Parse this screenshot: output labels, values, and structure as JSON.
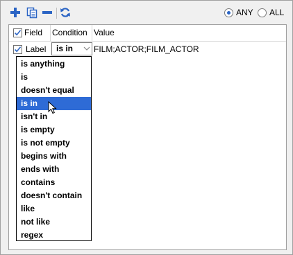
{
  "toolbar": {
    "add_icon": "plus-icon",
    "copy_icon": "copy-icon",
    "remove_icon": "minus-icon",
    "refresh_icon": "refresh-icon"
  },
  "match_mode": {
    "options": [
      "ANY",
      "ALL"
    ],
    "selected": "ANY"
  },
  "grid": {
    "headers": {
      "field": "Field",
      "condition": "Condition",
      "value": "Value"
    },
    "header_checked": true,
    "rows": [
      {
        "checked": true,
        "field": "Label",
        "condition": "is in",
        "value": "FILM;ACTOR;FILM_ACTOR"
      }
    ]
  },
  "condition_dropdown": {
    "options": [
      "is anything",
      "is",
      "doesn't equal",
      "is in",
      "isn't in",
      "is empty",
      "is not empty",
      "begins with",
      "ends with",
      "contains",
      "doesn't contain",
      "like",
      "not like",
      "regex"
    ],
    "selected": "is in"
  },
  "colors": {
    "selection": "#2e6bd6",
    "icon_blue": "#2b64c4",
    "border": "#a0a0a0"
  }
}
